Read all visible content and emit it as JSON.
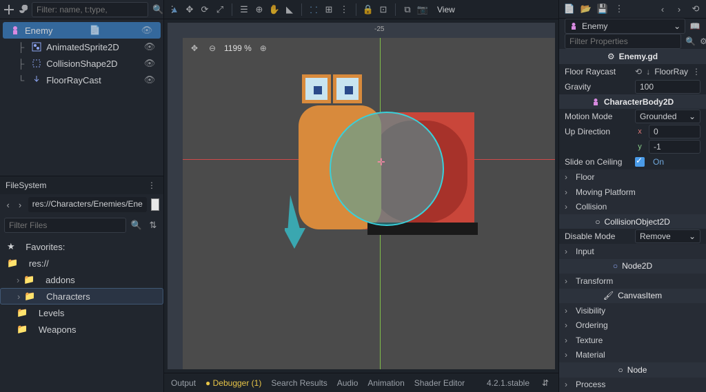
{
  "scene_toolbar": {
    "filter_placeholder": "Filter: name, t:type,"
  },
  "scene_tree": [
    {
      "name": "Enemy",
      "icon": "character-body",
      "depth": 0,
      "selected": true,
      "script": true,
      "visible": true
    },
    {
      "name": "AnimatedSprite2D",
      "icon": "animated-sprite",
      "depth": 1,
      "selected": false,
      "script": false,
      "visible": true
    },
    {
      "name": "CollisionShape2D",
      "icon": "collision-shape",
      "depth": 1,
      "selected": false,
      "script": false,
      "visible": true
    },
    {
      "name": "FloorRayCast",
      "icon": "raycast",
      "depth": 1,
      "selected": false,
      "script": false,
      "visible": true
    }
  ],
  "filesystem": {
    "header": "FileSystem",
    "path": "res://Characters/Enemies/Ene",
    "filter_placeholder": "Filter Files",
    "favorites": "Favorites:",
    "root": "res://",
    "folders": [
      {
        "name": "addons",
        "sel": false
      },
      {
        "name": "Characters",
        "sel": true
      },
      {
        "name": "Levels",
        "sel": false
      },
      {
        "name": "Weapons",
        "sel": false
      }
    ]
  },
  "viewport": {
    "zoom": "1199 %",
    "ruler_mark": "-25",
    "view_btn": "View"
  },
  "bottom_tabs": {
    "output": "Output",
    "debugger": "Debugger (1)",
    "search": "Search Results",
    "audio": "Audio",
    "animation": "Animation",
    "shader": "Shader Editor",
    "version": "4.2.1.stable"
  },
  "inspector": {
    "node": "Enemy",
    "filter_placeholder": "Filter Properties",
    "script_header": "Enemy.gd",
    "floor_raycast_label": "Floor Raycast",
    "floor_raycast_value": "FloorRay",
    "gravity_label": "Gravity",
    "gravity_value": "100",
    "cls_characterbody": "CharacterBody2D",
    "motion_mode_label": "Motion Mode",
    "motion_mode_value": "Grounded",
    "up_direction_label": "Up Direction",
    "up_x": "0",
    "up_y": "-1",
    "slide_ceiling_label": "Slide on Ceiling",
    "slide_ceiling_value": "On",
    "floor": "Floor",
    "moving_platform": "Moving Platform",
    "collision": "Collision",
    "cls_collisionobj": "CollisionObject2D",
    "disable_mode_label": "Disable Mode",
    "disable_mode_value": "Remove",
    "input": "Input",
    "cls_node2d": "Node2D",
    "transform": "Transform",
    "cls_canvasitem": "CanvasItem",
    "visibility": "Visibility",
    "ordering": "Ordering",
    "texture": "Texture",
    "material": "Material",
    "cls_node": "Node",
    "process": "Process"
  }
}
